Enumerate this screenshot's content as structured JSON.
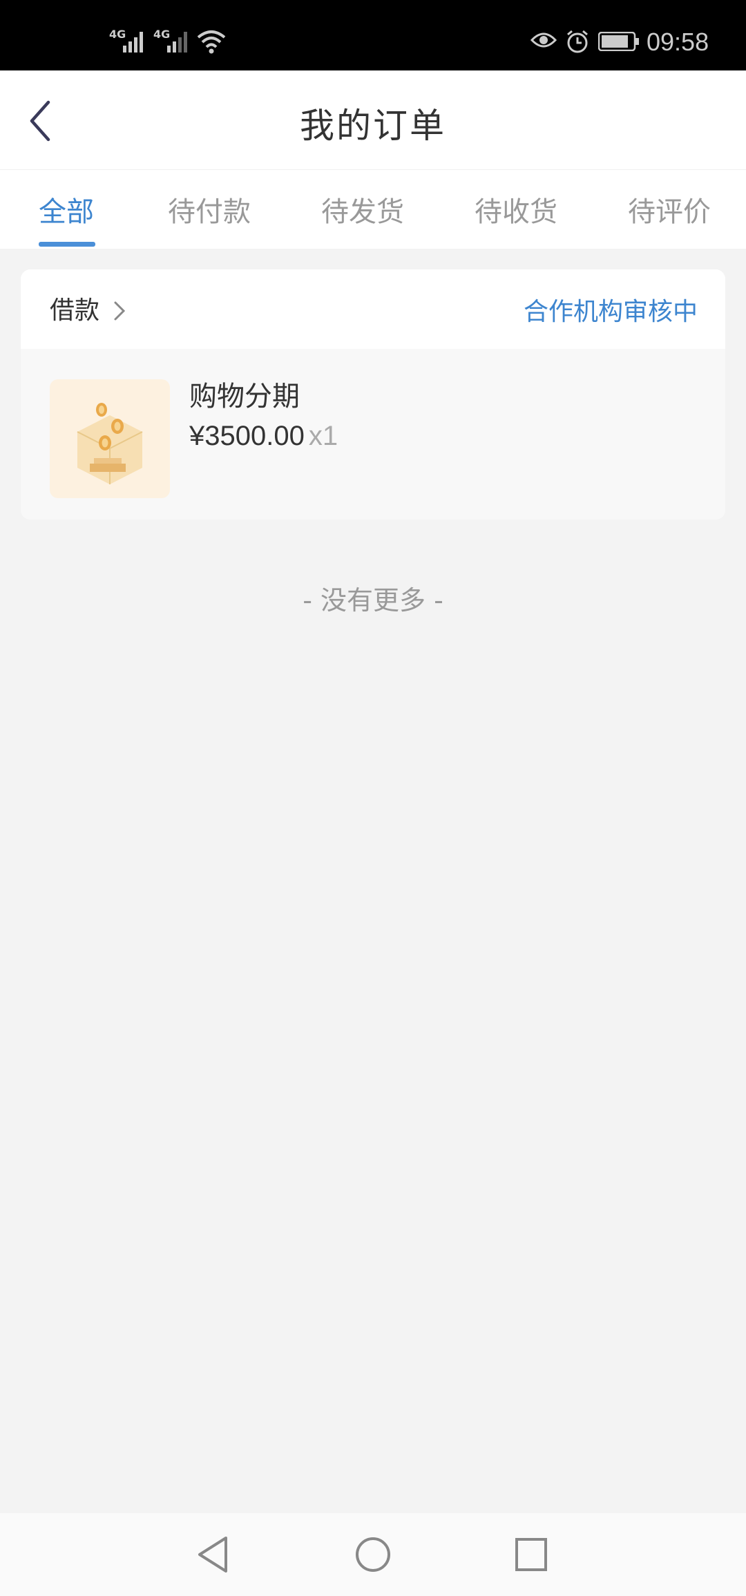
{
  "status_bar": {
    "net1": "4G",
    "net2": "4G",
    "time": "09:58",
    "icons": [
      "signal-icon",
      "signal-icon",
      "wifi-icon",
      "eye-icon",
      "alarm-icon",
      "battery-icon"
    ]
  },
  "header": {
    "title": "我的订单",
    "back_icon": "back-chevron-icon"
  },
  "tabs": [
    {
      "label": "全部",
      "active": true
    },
    {
      "label": "待付款",
      "active": false
    },
    {
      "label": "待发货",
      "active": false
    },
    {
      "label": "待收货",
      "active": false
    },
    {
      "label": "待评价",
      "active": false
    }
  ],
  "order": {
    "merchant": "借款",
    "status": "合作机构审核中",
    "product_name": "购物分期",
    "price": "¥3500.00",
    "quantity": "x1"
  },
  "footer_note": "- 没有更多 -",
  "system_nav": [
    "back-triangle-icon",
    "home-circle-icon",
    "recents-square-icon"
  ],
  "colors": {
    "accent": "#3d85cf",
    "background": "#f3f3f3"
  }
}
